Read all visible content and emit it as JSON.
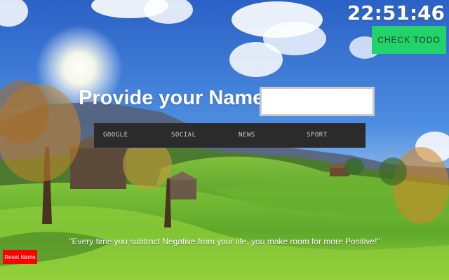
{
  "clock": {
    "time": "22:51:46"
  },
  "todo": {
    "label": "CHECK TODO"
  },
  "name_prompt": {
    "label": "Provide your Name :",
    "value": ""
  },
  "nav": {
    "items": [
      "GOOGLE",
      "SOCIAL",
      "NEWS",
      "SPORT"
    ]
  },
  "quote": {
    "text": "\"Every time you subtract Negative from your life, you make room for more Positive!\""
  },
  "reset": {
    "label": "Reset Name"
  },
  "colors": {
    "todo_bg": "#22d26a",
    "nav_bg": "#2b2b2b",
    "reset_bg": "#ff0000"
  }
}
